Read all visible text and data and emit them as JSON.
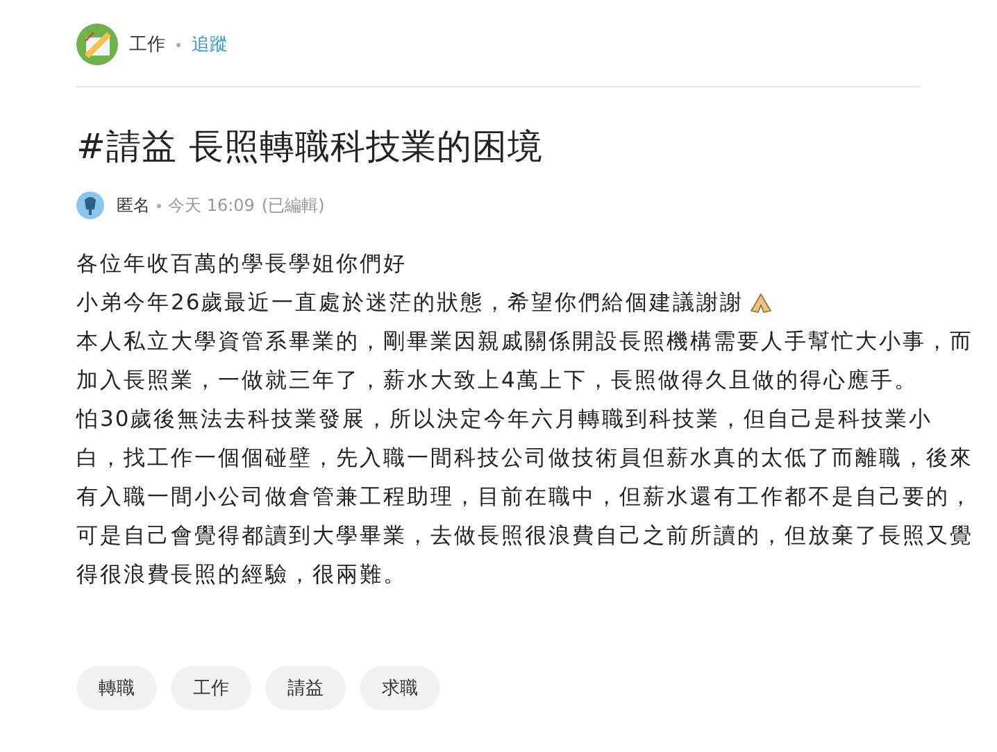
{
  "forum": {
    "name": "工作",
    "follow": "追蹤"
  },
  "post": {
    "title": "#請益 長照轉職科技業的困境",
    "author": "匿名",
    "time": "今天 16:09",
    "edited": "(已編輯)",
    "lines": [
      {
        "text": "各位年收百萬的學長學姐你們好"
      },
      {
        "text": "小弟今年26歲最近一直處於迷茫的狀態，希望你們給個建議謝謝",
        "kind": "pray"
      },
      {
        "text": "本人私立大學資管系畢業的，剛畢業因親戚關係開設長照機構需要人手幫忙大小事，而"
      },
      {
        "text": "加入長照業，一做就三年了，薪水大致上4萬上下，長照做得久且做的得心應手。"
      },
      {
        "text": "怕30歲後無法去科技業發展，所以決定今年六月轉職到科技業，但自己是科技業小"
      },
      {
        "text": "白，找工作一個個碰壁，先入職一間科技公司做技術員但薪水真的太低了而離職，後來"
      },
      {
        "text": "有入職一間小公司做倉管兼工程助理，目前在職中，但薪水還有工作都不是自己要的，"
      },
      {
        "text": "可是自己會覺得都讀到大學畢業，去做長照很浪費自己之前所讀的，但放棄了長照又覺"
      },
      {
        "text": "得很浪費長照的經驗，很兩難。"
      }
    ],
    "tags": [
      "轉職",
      "工作",
      "請益",
      "求職"
    ]
  }
}
